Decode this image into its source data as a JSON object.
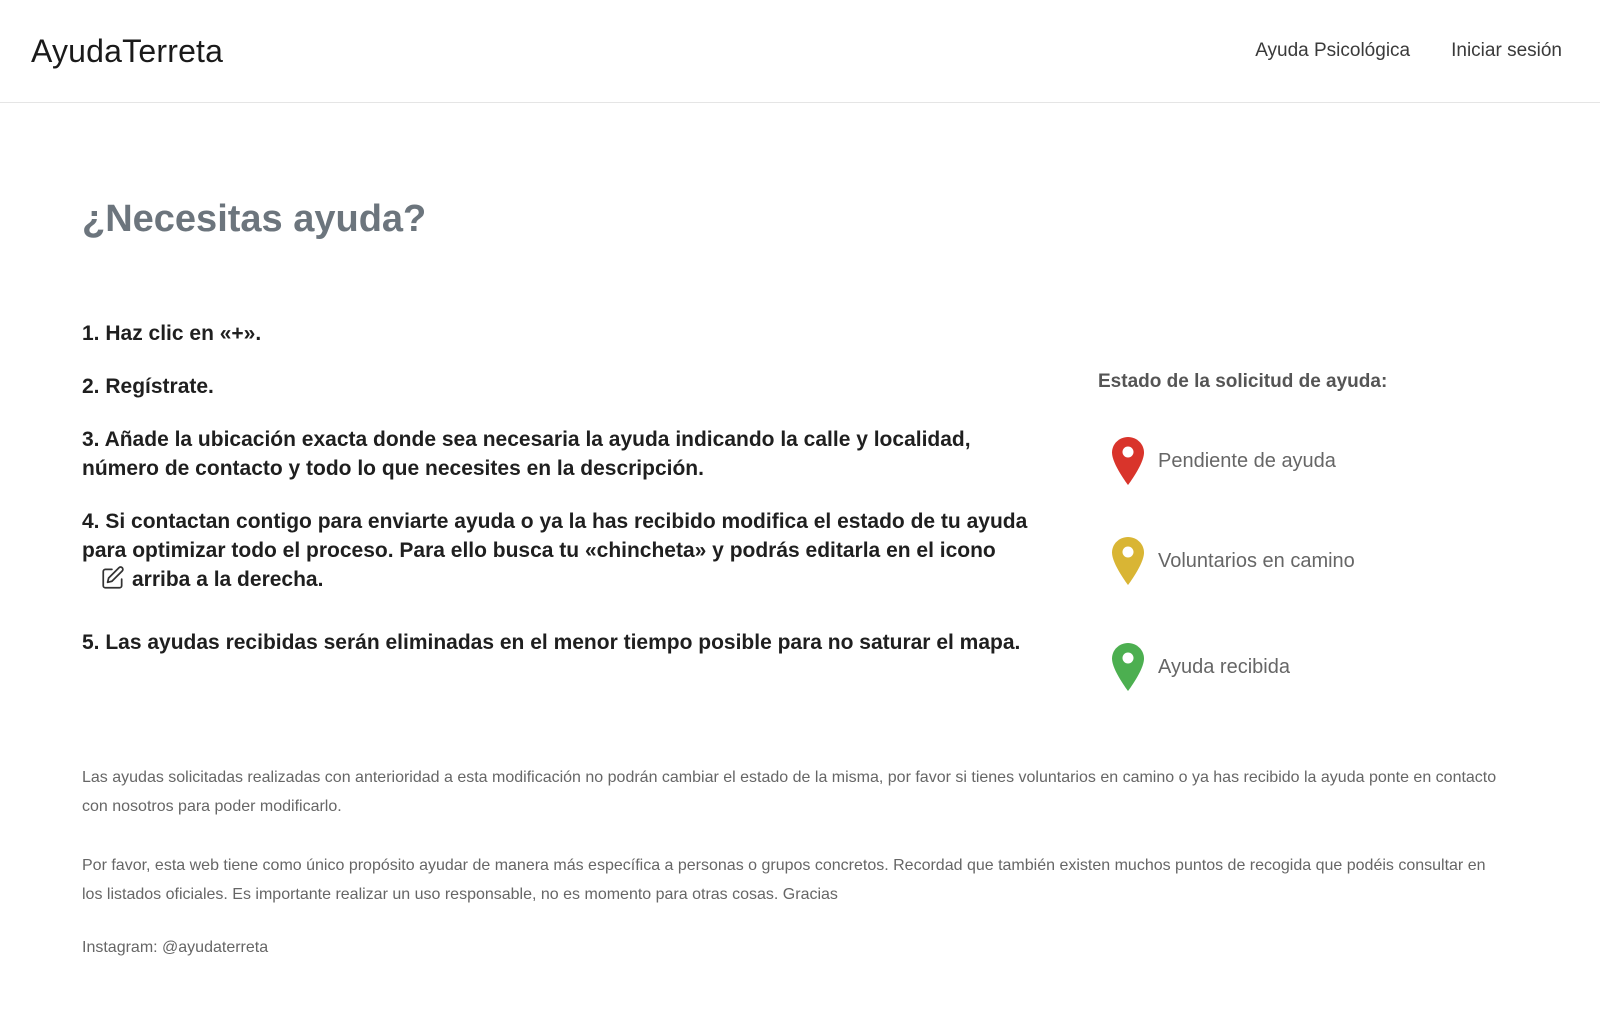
{
  "navbar": {
    "brand": "AyudaTerreta",
    "links": [
      "Ayuda Psicológica",
      "Iniciar sesión"
    ]
  },
  "main": {
    "title": "¿Necesitas ayuda?",
    "steps": [
      "1. Haz clic en «+».",
      "2. Regístrate.",
      "3. Añade la ubicación exacta donde sea necesaria la ayuda indicando la calle y localidad, número de contacto y todo lo que necesites en la descripción.",
      "4. Si contactan contigo para enviarte ayuda o ya la has recibido modifica el estado de tu ayuda para optimizar todo el proceso. Para ello busca tu «chincheta» y podrás editarla en el icono",
      "arriba a la derecha.",
      "5. Las ayudas recibidas serán eliminadas en el menor tiempo posible para no saturar el mapa."
    ],
    "step4_icon": "edit-icon"
  },
  "status_panel": {
    "title": "Estado de la solicitud de ayuda:",
    "items": [
      {
        "label": "Pendiente de ayuda",
        "icon": "red-map-pin-icon",
        "color": "#d9342b"
      },
      {
        "label": "Voluntarios en camino",
        "icon": "yellow-map-pin-icon",
        "color": "#d9b534"
      },
      {
        "label": "Ayuda recibida",
        "icon": "green-map-pin-icon",
        "color": "#4caf50"
      }
    ]
  },
  "notes": [
    "Las ayudas solicitadas realizadas con anterioridad a esta modificación no podrán cambiar el estado de la misma, por favor si tienes voluntarios en camino o ya has recibido la ayuda ponte en contacto con nosotros para poder modificarlo.",
    "Por favor, esta web tiene como único propósito ayudar de manera más específica a personas o grupos concretos. Recordad que también existen muchos puntos de recogida que podéis consultar en los listados oficiales. Es importante realizar un uso responsable, no es momento para otras cosas. Gracias"
  ],
  "instagram": "Instagram: @ayudaterreta"
}
